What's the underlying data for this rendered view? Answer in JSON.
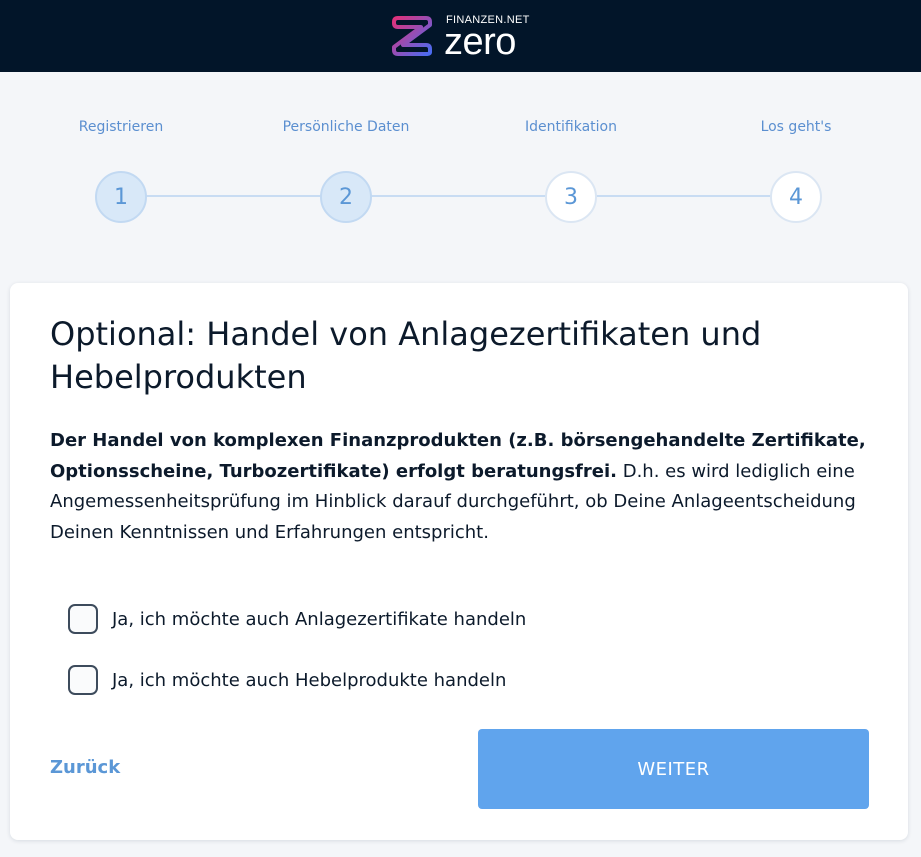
{
  "header": {
    "brand": "FINANZEN.NET",
    "wordmark": "zero",
    "logo_icon": "z-logo-icon",
    "colors": {
      "background": "#021529",
      "logo_gradient_start": "#e0317a",
      "logo_gradient_end": "#4a6cf2"
    }
  },
  "stepper": {
    "steps": [
      {
        "label": "Registrieren",
        "number": "1",
        "state": "completed"
      },
      {
        "label": "Persönliche Daten",
        "number": "2",
        "state": "completed"
      },
      {
        "label": "Identifikation",
        "number": "3",
        "state": "upcoming"
      },
      {
        "label": "Los geht's",
        "number": "4",
        "state": "upcoming"
      }
    ]
  },
  "card": {
    "title": "Optional: Handel von Anlagezertifikaten und Hebelprodukten",
    "text_bold": "Der Handel von komplexen Finanzprodukten (z.B. börsengehandelte Zertifikate, Optionsscheine, Turbozertifikate) erfolgt beratungsfrei.",
    "text_regular": " D.h. es wird lediglich eine Angemessenheitsprüfung im Hinblick darauf durchgeführt, ob Deine Anlageentscheidung Deinen Kenntnissen und Erfahrungen entspricht.",
    "checkboxes": [
      {
        "label": "Ja, ich möchte auch Anlagezertifikate handeln",
        "checked": false
      },
      {
        "label": "Ja, ich möchte auch Hebelprodukte handeln",
        "checked": false
      }
    ],
    "back_label": "Zurück",
    "next_label": "WEITER"
  },
  "colors": {
    "accent": "#60a4ed",
    "link": "#5b97d6",
    "page_bg": "#f4f6f9"
  }
}
